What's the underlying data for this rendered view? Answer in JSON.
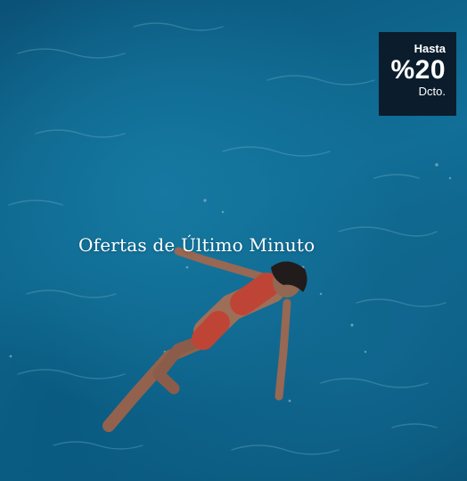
{
  "promo": {
    "title": "Ofertas de Último Minuto",
    "badge": {
      "top": "Hasta",
      "main": "%20",
      "bottom": "Dcto."
    }
  },
  "colors": {
    "water": "#1585b4",
    "badge_bg": "#0b1d2c",
    "text": "#ffffff",
    "swimsuit": "#e8503a"
  },
  "image": {
    "subject": "swimmer-floating-in-pool"
  }
}
